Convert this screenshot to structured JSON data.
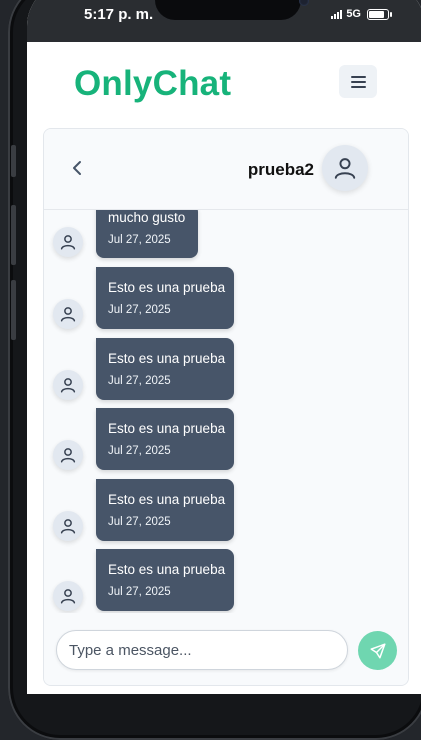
{
  "statusbar": {
    "time": "5:17 p. m.",
    "network": "5G"
  },
  "header": {
    "brand": "OnlyChat"
  },
  "chat": {
    "contact_name": "prueba2",
    "messages": [
      {
        "text": "mucho gusto",
        "date": "Jul 27, 2025"
      },
      {
        "text": "Esto es una prueba",
        "date": "Jul 27, 2025"
      },
      {
        "text": "Esto es una prueba",
        "date": "Jul 27, 2025"
      },
      {
        "text": "Esto es una prueba",
        "date": "Jul 27, 2025"
      },
      {
        "text": "Esto es una prueba",
        "date": "Jul 27, 2025"
      },
      {
        "text": "Esto es una prueba",
        "date": "Jul 27, 2025"
      }
    ]
  },
  "composer": {
    "placeholder": "Type a message..."
  },
  "colors": {
    "brand": "#17b37a",
    "bubble": "#475569",
    "send": "#6fd6b0"
  },
  "icons": {
    "menu": "hamburger-icon",
    "back": "chevron-left-icon",
    "avatar": "user-icon",
    "send": "send-icon"
  }
}
